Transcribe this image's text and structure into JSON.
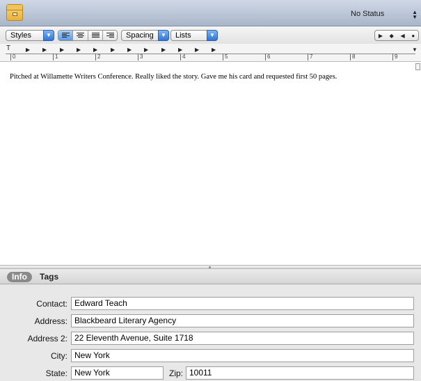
{
  "titlebar": {
    "icon": "document-box-icon",
    "status": "No Status"
  },
  "toolbar": {
    "styles_label": "Styles",
    "spacing_label": "Spacing",
    "lists_label": "Lists",
    "alignments": [
      "align-left",
      "align-center",
      "justify",
      "align-right"
    ],
    "active_alignment": "align-left",
    "accent_color": "#3b7fde"
  },
  "ruler": {
    "numbers": [
      "0",
      "1",
      "2",
      "3",
      "4",
      "5",
      "6",
      "7",
      "8",
      "9"
    ]
  },
  "document": {
    "text": "Pitched at Willamette Writers Conference. Really liked the story. Gave me his card and requested first 50 pages."
  },
  "inspector": {
    "tabs": [
      "Info",
      "Tags"
    ],
    "active_tab": "Info",
    "fields": {
      "contact_label": "Contact:",
      "contact_value": "Edward Teach",
      "address_label": "Address:",
      "address_value": "Blackbeard Literary Agency",
      "address2_label": "Address 2:",
      "address2_value": "22 Eleventh Avenue, Suite 1718",
      "city_label": "City:",
      "city_value": "New York",
      "state_label": "State:",
      "state_value": "New York",
      "zip_label": "Zip:",
      "zip_value": "10011"
    }
  }
}
